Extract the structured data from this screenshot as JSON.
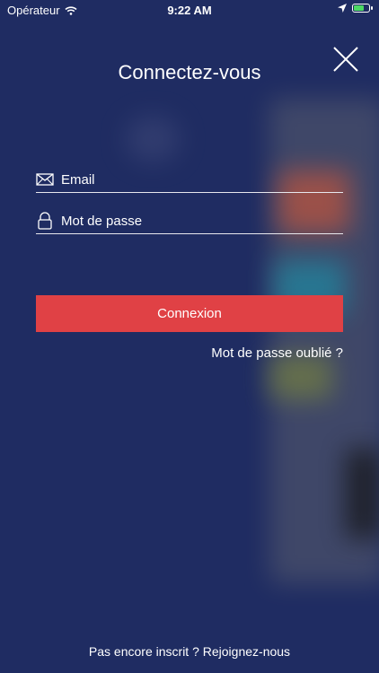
{
  "status_bar": {
    "carrier": "Opérateur",
    "time": "9:22 AM"
  },
  "header": {
    "title": "Connectez-vous",
    "close_icon": "close-icon"
  },
  "form": {
    "email_placeholder": "Email",
    "email_value": "",
    "email_icon": "envelope-icon",
    "password_placeholder": "Mot de passe",
    "password_value": "",
    "password_icon": "lock-icon",
    "login_label": "Connexion",
    "forgot_label": "Mot de passe oublié ?"
  },
  "footer": {
    "prompt": "Pas encore inscrit ?",
    "join_label": "Rejoignez-nous"
  },
  "colors": {
    "background": "#1f2c62",
    "button": "#e04145",
    "text": "#ffffff"
  }
}
